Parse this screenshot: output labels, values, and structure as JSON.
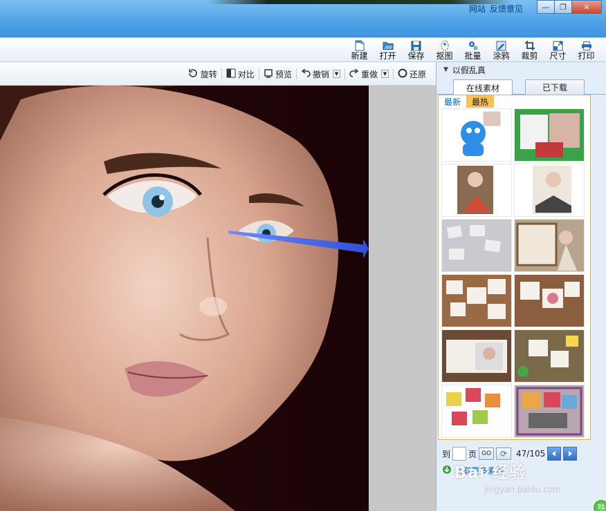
{
  "title_links": [
    "网站",
    "反馈意见"
  ],
  "window_buttons": [
    "minimize",
    "restore",
    "close"
  ],
  "toolbar": {
    "items": [
      {
        "label": "新建",
        "icon": "new-file-icon"
      },
      {
        "label": "打开",
        "icon": "folder-open-icon"
      },
      {
        "label": "保存",
        "icon": "save-icon"
      },
      {
        "label": "抠图",
        "icon": "cutout-icon"
      },
      {
        "label": "批量",
        "icon": "batch-gear-icon"
      },
      {
        "label": "涂鸦",
        "icon": "graffiti-icon"
      },
      {
        "label": "裁剪",
        "icon": "crop-icon"
      },
      {
        "label": "尺寸",
        "icon": "resize-icon"
      },
      {
        "label": "打印",
        "icon": "printer-icon"
      }
    ]
  },
  "subtoolbar": {
    "rotate": "旋转",
    "compare": "对比",
    "preview": "预览",
    "undo": "撤销",
    "redo": "重做",
    "restore": "还原"
  },
  "panel": {
    "title": "以假乱真",
    "tabs": {
      "online": "在线素材",
      "downloaded": "已下载"
    },
    "subtabs": {
      "newest": "最新",
      "hottest": "最热"
    },
    "pager": {
      "to_label": "到",
      "page_label": "页",
      "go_label": "GO",
      "page_count": "47/105"
    },
    "more_link": "获取更多素材"
  },
  "watermark": {
    "brand": "Bai 经验",
    "url": "jingyan.baidu.com"
  },
  "corner_badge": "71",
  "colors": {
    "accent": "#3d93de",
    "hot_tab": "#f6c157",
    "arrow": "#2f4fd6"
  }
}
